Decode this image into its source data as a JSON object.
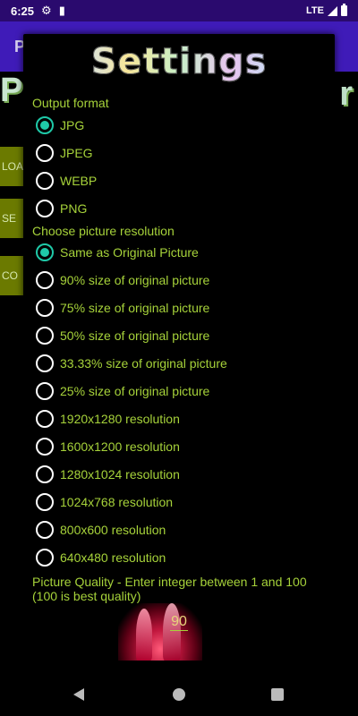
{
  "status_bar": {
    "time": "6:25",
    "network": "LTE"
  },
  "background": {
    "app_bar_title": "P",
    "title_left": "P",
    "title_right": "r",
    "buttons": [
      "LOA",
      "SE",
      "CO"
    ]
  },
  "dialog": {
    "title": "Settings",
    "output_format_label": "Output format",
    "formats": [
      {
        "label": "JPG",
        "checked": true
      },
      {
        "label": "JPEG",
        "checked": false
      },
      {
        "label": "WEBP",
        "checked": false
      },
      {
        "label": "PNG",
        "checked": false
      }
    ],
    "resolution_label": "Choose picture resolution",
    "resolutions": [
      {
        "label": "Same as Original Picture",
        "checked": true
      },
      {
        "label": "90% size of original picture",
        "checked": false
      },
      {
        "label": "75% size of original picture",
        "checked": false
      },
      {
        "label": "50% size of original picture",
        "checked": false
      },
      {
        "label": "33.33% size of original picture",
        "checked": false
      },
      {
        "label": "25% size of original picture",
        "checked": false
      },
      {
        "label": "1920x1280 resolution",
        "checked": false
      },
      {
        "label": "1600x1200 resolution",
        "checked": false
      },
      {
        "label": "1280x1024 resolution",
        "checked": false
      },
      {
        "label": "1024x768 resolution",
        "checked": false
      },
      {
        "label": "800x600 resolution",
        "checked": false
      },
      {
        "label": "640x480 resolution",
        "checked": false
      }
    ],
    "quality_label": "Picture Quality - Enter integer between 1 and 100 (100 is best quality)",
    "quality_value": "90"
  },
  "colors": {
    "accent": "#1fc9a8",
    "text": "#a6d23a",
    "status_bar": "#2a0a6e",
    "app_bar": "#3f1bb8"
  }
}
